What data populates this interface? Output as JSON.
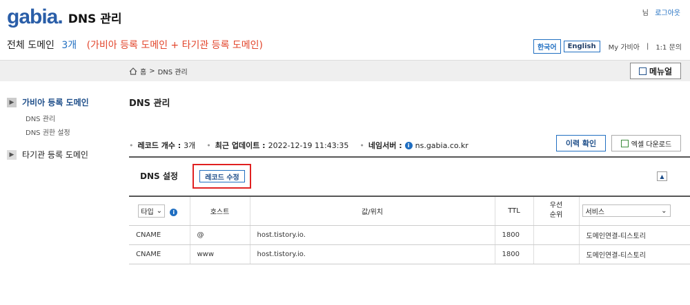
{
  "header": {
    "logo_text": "gabia.",
    "page_title": "DNS 관리",
    "user_suffix": "님",
    "logout_label": "로그아웃"
  },
  "domain_bar": {
    "label": "전체 도메인",
    "count": "3개",
    "desc": "(가비아 등록 도메인 + 타기관 등록 도메인)",
    "lang_ko": "한국어",
    "lang_en": "English",
    "my_gabia": "My 가비아",
    "sep": "|",
    "inquiry": "1:1 문의"
  },
  "breadcrumb": {
    "home": "홈",
    "sep": ">",
    "current": "DNS 관리"
  },
  "manual_label": "메뉴얼",
  "sidebar": {
    "groups": [
      {
        "label": "가비아 등록 도메인",
        "items": [
          "DNS 관리",
          "DNS 권한 설정"
        ]
      },
      {
        "label": "타기관 등록 도메인"
      }
    ]
  },
  "main": {
    "title": "DNS 관리",
    "record_count_label": "레코드 개수 :",
    "record_count": "3개",
    "updated_label": "최근 업데이트 :",
    "updated_value": "2022-12-19 11:43:35",
    "ns_label": "네임서버 :",
    "ns_value": "ns.gabia.co.kr",
    "history_button": "이력 확인",
    "excel_button": "엑셀 다운로드",
    "settings_title": "DNS 설정",
    "edit_button": "레코드 수정"
  },
  "table": {
    "type_filter": "타입",
    "columns": {
      "host": "호스트",
      "value": "값/위치",
      "ttl": "TTL",
      "priority_1": "우선",
      "priority_2": "순위",
      "service_select": "서비스"
    },
    "rows": [
      {
        "type": "CNAME",
        "host": "@",
        "value": "host.tistory.io.",
        "ttl": "1800",
        "priority": "",
        "service": "도메인연결-티스토리"
      },
      {
        "type": "CNAME",
        "host": "www",
        "value": "host.tistory.io.",
        "ttl": "1800",
        "priority": "",
        "service": "도메인연결-티스토리"
      }
    ]
  },
  "colors": {
    "brand_blue": "#1f6ec1",
    "accent_red": "#e2452b",
    "highlight_red": "#e02020"
  }
}
